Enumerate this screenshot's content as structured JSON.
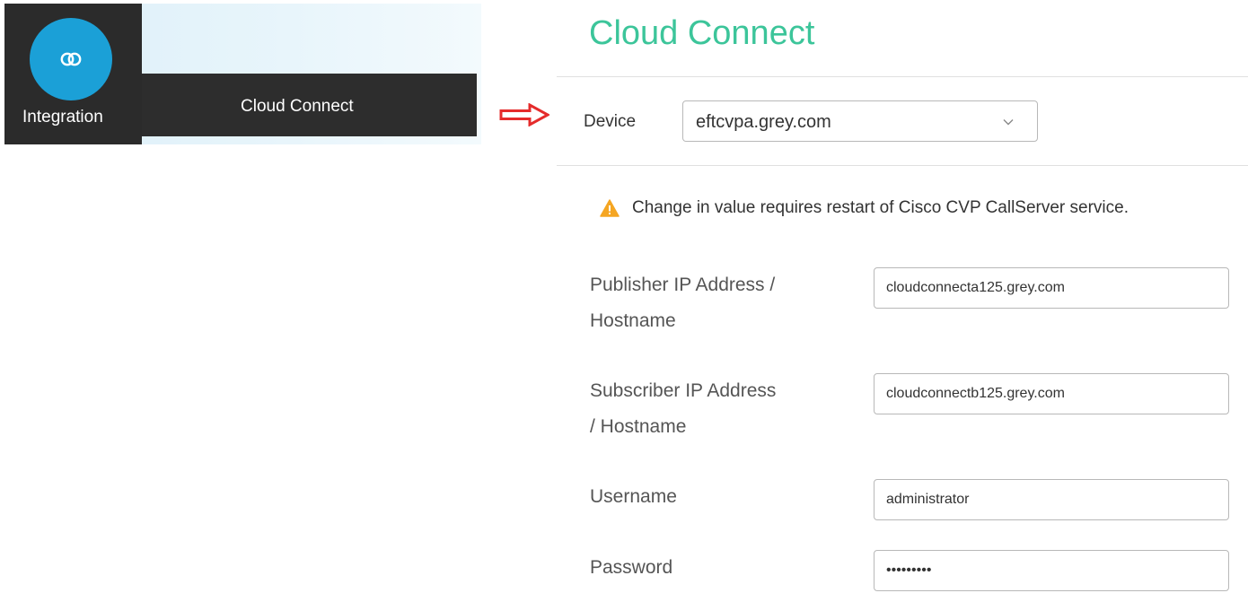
{
  "nav": {
    "tile_label": "Integration",
    "bar_label": "Cloud Connect",
    "accent_color": "#1ba0d7",
    "tile_icon": "integration-rings-icon"
  },
  "annotation": {
    "arrow_color": "#e52b2b",
    "arrow_icon": "right-arrow-outline-icon"
  },
  "page": {
    "title": "Cloud Connect",
    "title_color": "#3cc59a"
  },
  "device": {
    "label": "Device",
    "selected": "eftcvpa.grey.com"
  },
  "warning": {
    "icon": "warning-triangle-icon",
    "color": "#f5a623",
    "text": "Change in value requires restart of Cisco CVP CallServer service."
  },
  "form": {
    "publisher": {
      "label_line1": "Publisher IP Address /",
      "label_line2": "Hostname",
      "value": "cloudconnecta125.grey.com"
    },
    "subscriber": {
      "label_line1": "Subscriber IP Address",
      "label_line2": "/ Hostname",
      "value": "cloudconnectb125.grey.com"
    },
    "username": {
      "label": "Username",
      "value": "administrator"
    },
    "password": {
      "label": "Password",
      "value": "passwordx"
    }
  }
}
